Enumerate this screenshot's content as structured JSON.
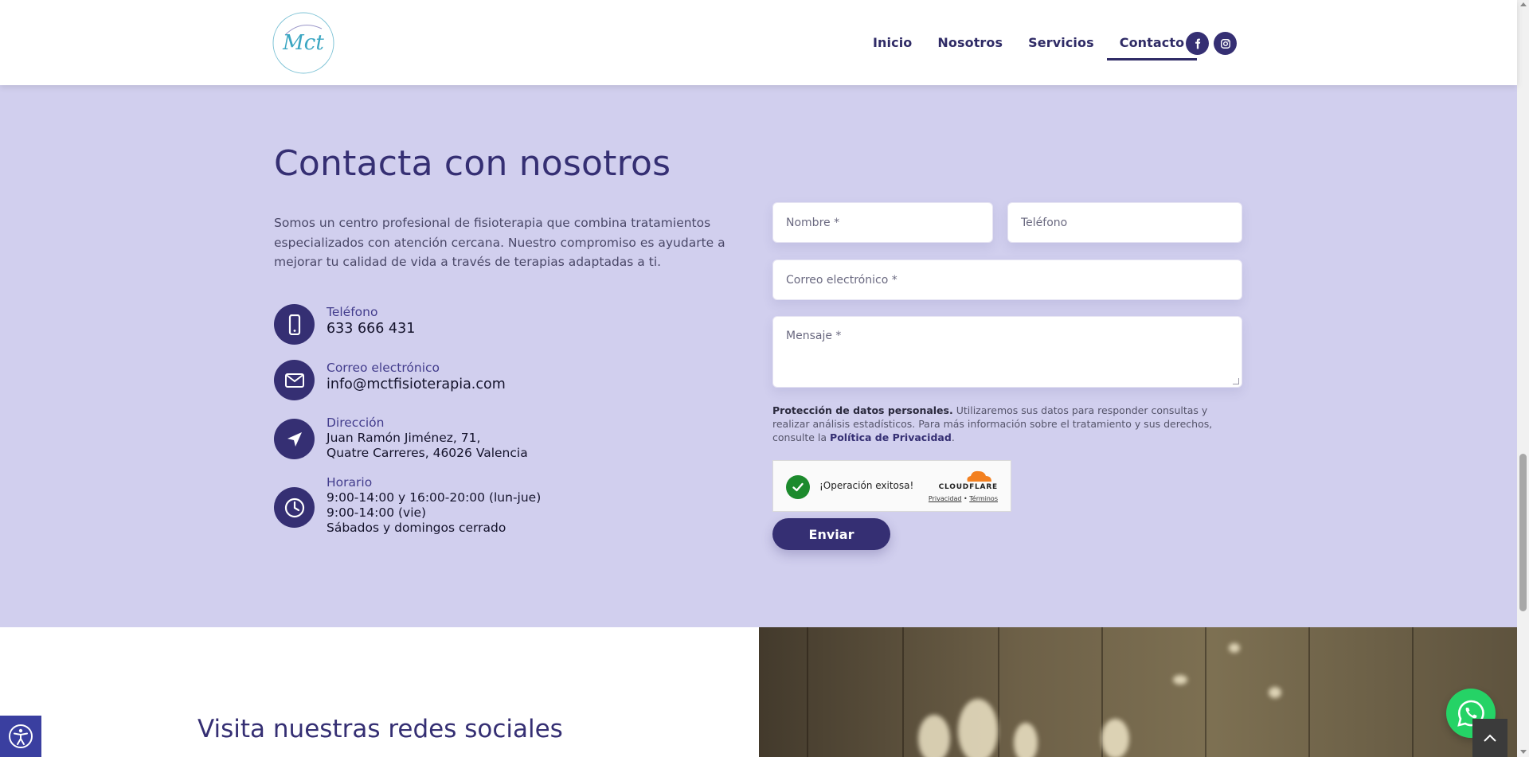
{
  "header": {
    "logo_text": "Mct",
    "nav": [
      {
        "label": "Inicio"
      },
      {
        "label": "Nosotros"
      },
      {
        "label": "Servicios"
      },
      {
        "label": "Contacto",
        "active": true
      }
    ],
    "social": [
      "facebook-icon",
      "instagram-icon"
    ]
  },
  "contact": {
    "title": "Contacta con nosotros",
    "intro": "Somos un centro profesional de fisioterapia que combina tratamientos especializados con atención cercana. Nuestro compromiso es ayudarte a mejorar tu calidad de vida a través de terapias adaptadas a ti.",
    "phone": {
      "label": "Teléfono",
      "value": "633 666 431"
    },
    "email": {
      "label": "Correo electrónico",
      "value": "info@mctfisioterapia.com"
    },
    "address": {
      "label": "Dirección",
      "line1": "Juan Ramón Jiménez, 71,",
      "line2": "Quatre Carreres, 46026 Valencia"
    },
    "hours": {
      "label": "Horario",
      "line1": "9:00-14:00 y 16:00-20:00 (lun-jue)",
      "line2": "9:00-14:00 (vie)",
      "line3": "Sábados y domingos cerrado"
    }
  },
  "form": {
    "name_placeholder": "Nombre *",
    "phone_placeholder": "Teléfono",
    "email_placeholder": "Correo electrónico *",
    "message_placeholder": "Mensaje *",
    "privacy_bold": "Protección de datos personales.",
    "privacy_text": " Utilizaremos sus datos para responder consultas y realizar análisis estadísticos. Para más información sobre el tratamiento y sus derechos, consulte la ",
    "privacy_link": "Política de Privacidad",
    "privacy_end": ".",
    "captcha_status": "¡Operación exitosa!",
    "captcha_brand": "CLOUDFLARE",
    "captcha_privacy": "Privacidad",
    "captcha_sep": " • ",
    "captcha_terms": "Términos",
    "submit_label": "Enviar"
  },
  "lower": {
    "title": "Visita nuestras redes sociales"
  },
  "colors": {
    "primary": "#352f73",
    "band": "#d1cfee",
    "whatsapp": "#25d366"
  }
}
